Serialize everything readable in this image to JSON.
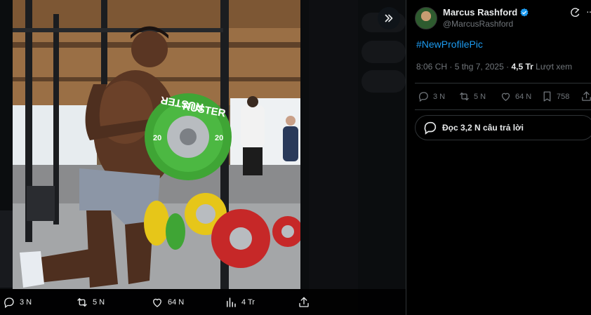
{
  "author": {
    "display_name": "Marcus Rashford",
    "handle": "@MarcusRashford"
  },
  "tweet": {
    "text": "#NewProfilePic",
    "time": "8:06 CH",
    "separator": "·",
    "date": "5 thg 7, 2025",
    "views_count": "4,5 Tr",
    "views_label": "Lượt xem"
  },
  "actions": {
    "replies": "3 N",
    "reposts": "5 N",
    "likes": "64 N",
    "bookmarks": "758"
  },
  "read_replies_label": "Đọc 3,2 N câu trả lời",
  "media_bar": {
    "replies": "3 N",
    "reposts": "5 N",
    "likes": "64 N",
    "views": "4 Tr"
  },
  "photo": {
    "plate_brand": "RUSTER",
    "plate_weight": "20"
  },
  "colors": {
    "accent": "#1d9bf0",
    "muted": "#71767b",
    "text": "#e7e9ea",
    "plate_green": "#3fa535",
    "plate_red": "#c62828",
    "plate_yellow": "#e6c619"
  },
  "icons": [
    "chevrons-right-icon",
    "verified-badge-icon",
    "grok-icon",
    "more-icon",
    "reply-icon",
    "repost-icon",
    "like-icon",
    "bookmark-icon",
    "share-icon",
    "views-icon",
    "chat-bubble-icon"
  ]
}
